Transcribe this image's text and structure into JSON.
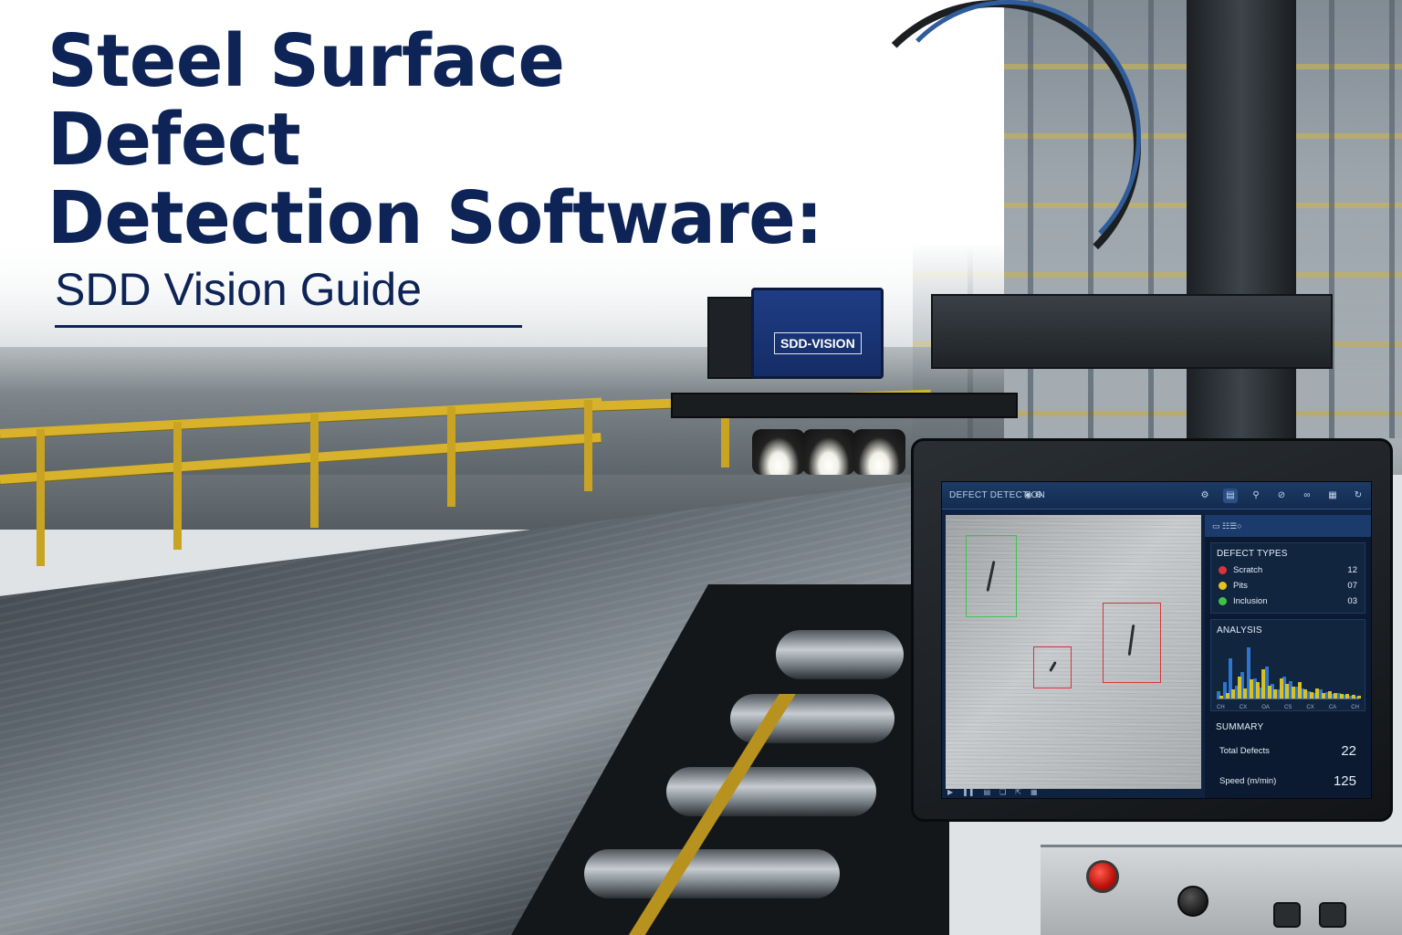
{
  "headline": {
    "title_line1": "Steel Surface Defect",
    "title_line2": "Detection Software:",
    "subtitle": "SDD Vision Guide"
  },
  "camera": {
    "label": "SDD-VISION"
  },
  "app": {
    "title": "DEFECT DETECTION",
    "panel_header": "▭ ☷☰○"
  },
  "defect_types": {
    "title": "DEFECT TYPES",
    "items": [
      {
        "name": "Scratch",
        "count": "12",
        "color": "#d9343a"
      },
      {
        "name": "Pits",
        "count": "07",
        "color": "#e5c21e"
      },
      {
        "name": "Inclusion",
        "count": "03",
        "color": "#3cc447"
      }
    ]
  },
  "analysis": {
    "title": "ANALYSIS",
    "tick_labels": [
      "CH",
      "CX",
      "OA",
      "CS",
      "CX",
      "CA",
      "CH"
    ]
  },
  "chart_data": {
    "type": "bar",
    "title": "ANALYSIS",
    "xlabel": "",
    "ylabel": "",
    "categories": [
      "CH",
      "CX",
      "OA",
      "CS",
      "CX",
      "CA",
      "CH"
    ],
    "series": [
      {
        "values": [
          10,
          22,
          55,
          18,
          36,
          70,
          28,
          15,
          44,
          20,
          12,
          30,
          24,
          16,
          14,
          10,
          8,
          12,
          9,
          6,
          7,
          5,
          4,
          3
        ]
      },
      {
        "values": [
          4,
          8,
          12,
          30,
          14,
          26,
          22,
          40,
          18,
          12,
          28,
          20,
          16,
          22,
          12,
          9,
          14,
          8,
          10,
          7,
          6,
          6,
          5,
          4
        ]
      }
    ],
    "colors": [
      "#2f7fe0",
      "#e3c81f"
    ],
    "ylim": [
      0,
      80
    ],
    "grid": true
  },
  "summary": {
    "title": "SUMMARY",
    "total_defects_label": "Total Defects",
    "total_defects_value": "22",
    "speed_label": "Speed (m/min)",
    "speed_value": "125"
  },
  "detections": [
    {
      "type": "Inclusion",
      "color": "#3cc447"
    },
    {
      "type": "Scratch",
      "color": "#d9343a"
    },
    {
      "type": "Scratch",
      "color": "#d9343a"
    }
  ]
}
